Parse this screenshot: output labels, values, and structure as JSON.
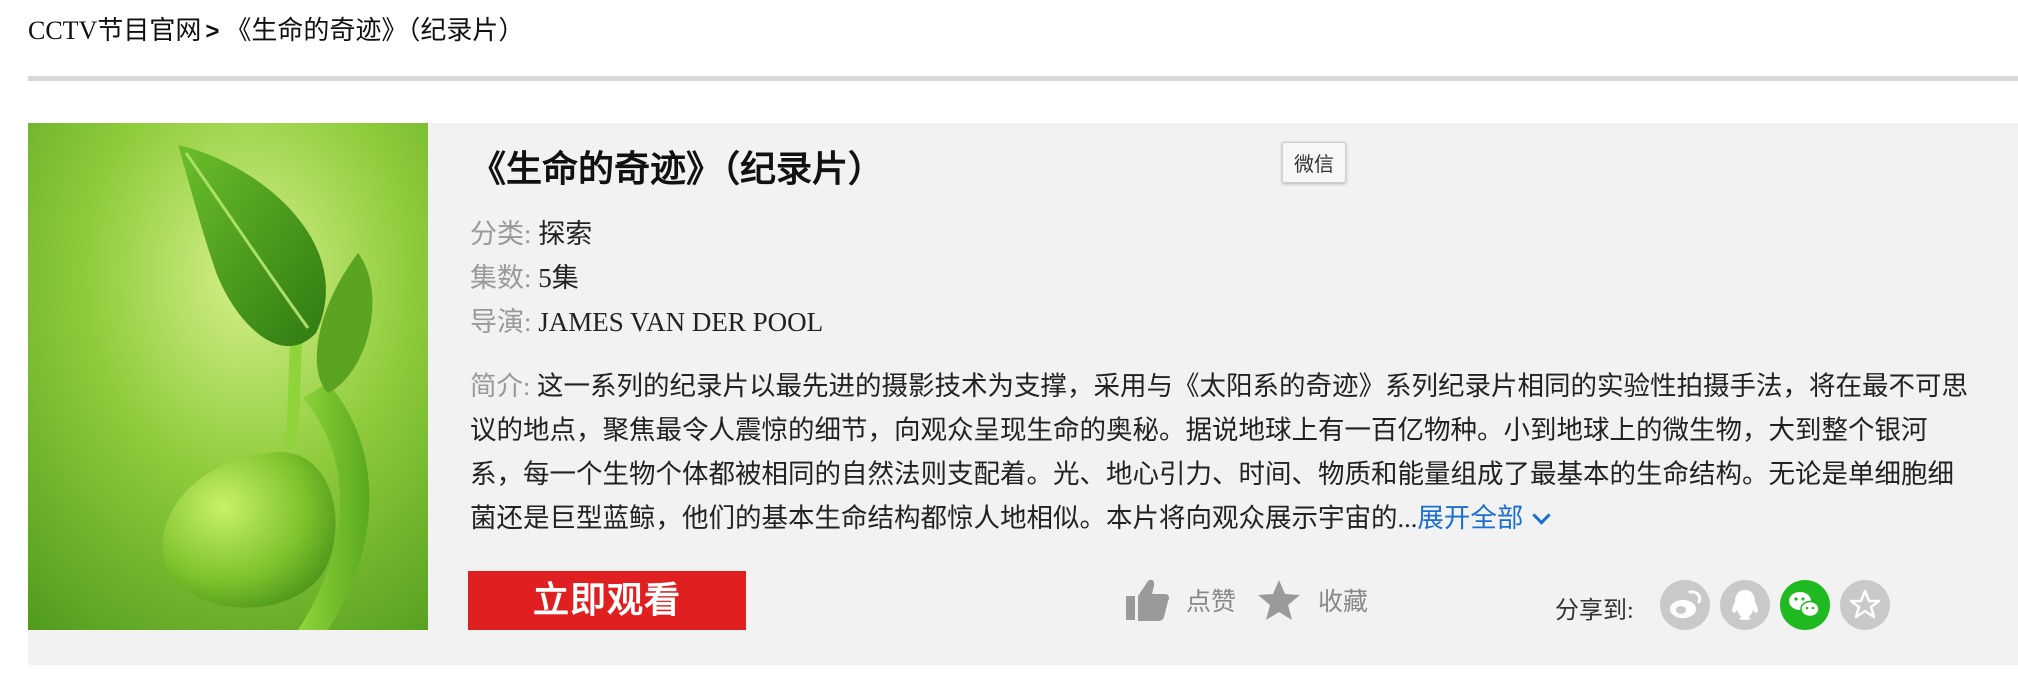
{
  "breadcrumb": {
    "site": "CCTV节目官网",
    "separator": ">",
    "current": "《生命的奇迹》（纪录片）"
  },
  "program": {
    "title": "《生命的奇迹》（纪录片）",
    "wechat_tooltip": "微信",
    "category_label": "分类:",
    "category": "探索",
    "episodes_label": "集数:",
    "episodes": "5集",
    "director_label": "导演:",
    "director": "JAMES VAN DER POOL",
    "intro_label": "简介:",
    "intro": "这一系列的纪录片以最先进的摄影技术为支撑，采用与《太阳系的奇迹》系列纪录片相同的实验性拍摄手法，将在最不可思议的地点，聚焦最令人震惊的细节，向观众呈现生命的奥秘。据说地球上有一百亿物种。小到地球上的微生物，大到整个银河系，每一个生物个体都被相同的自然法则支配着。光、地心引力、时间、物质和能量组成了最基本的生命结构。无论是单细胞细菌还是巨型蓝鲸，他们的基本生命结构都惊人地相似。本片将向观众展示宇宙的...",
    "expand_label": "展开全部"
  },
  "actions": {
    "watch_label": "立即观看",
    "like_label": "点赞",
    "favorite_label": "收藏",
    "share_label": "分享到:"
  },
  "share_targets": [
    "weibo-icon",
    "qq-icon",
    "wechat-icon",
    "qzone-icon"
  ],
  "colors": {
    "watch_button": "#e02020",
    "link": "#1a6fd0",
    "wechat_green": "#1fb922",
    "panel_bg": "#f2f2f2"
  }
}
